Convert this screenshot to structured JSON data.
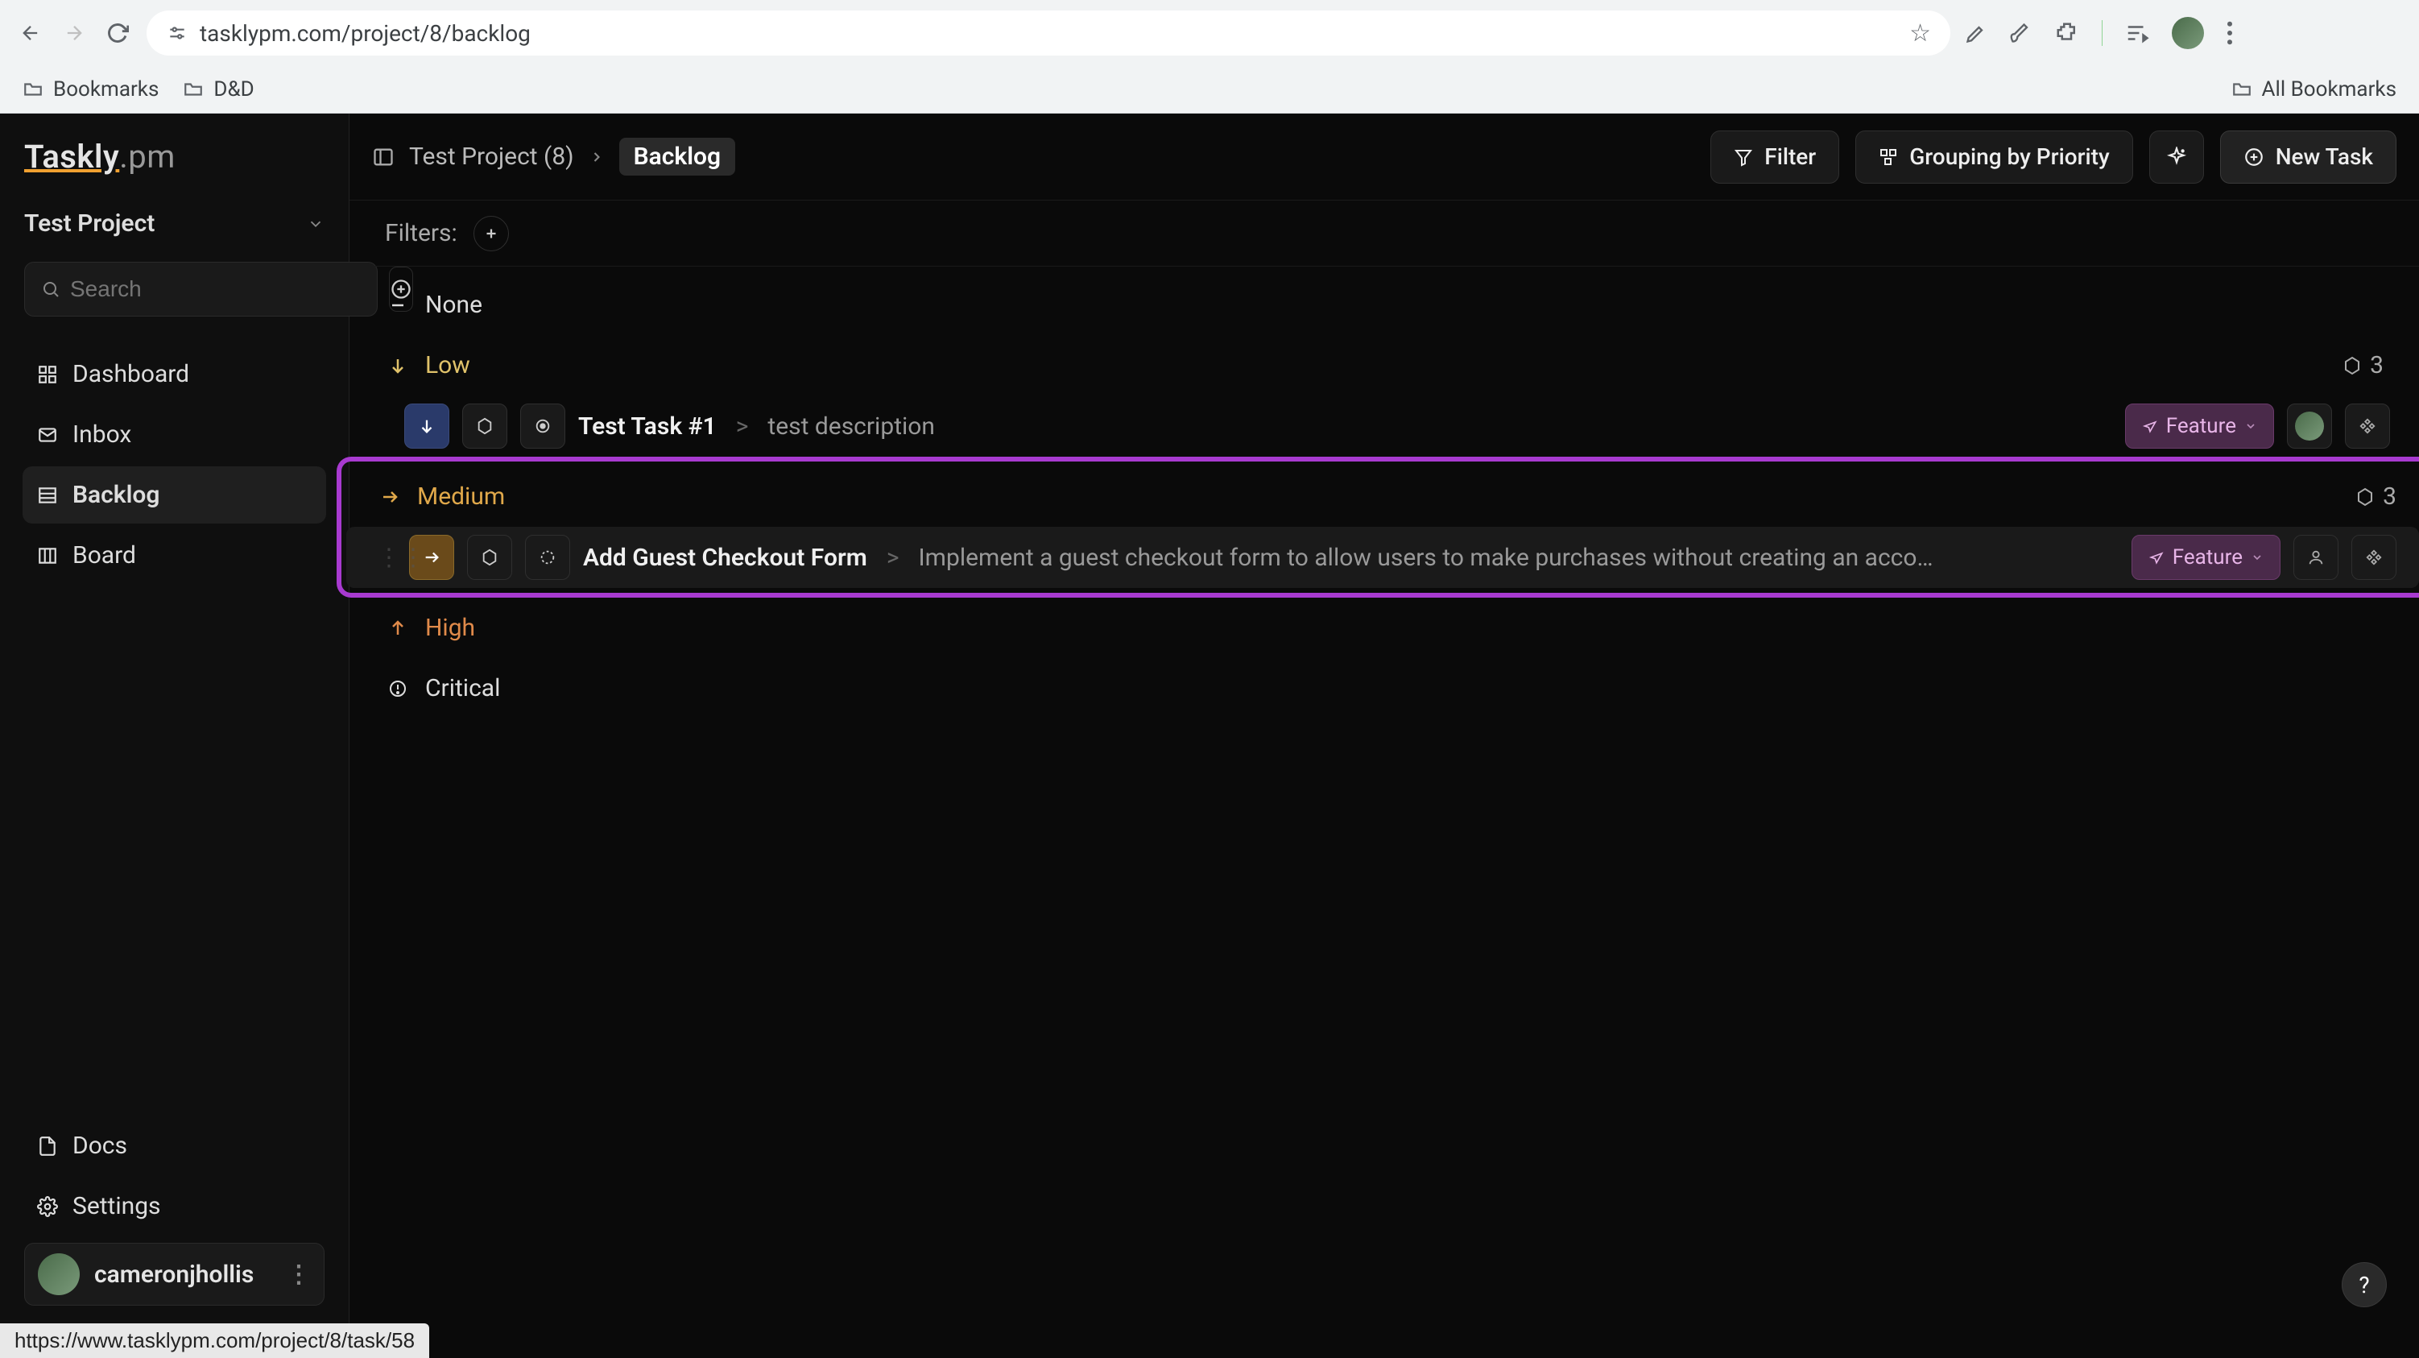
{
  "browser": {
    "url": "tasklypm.com/project/8/backlog",
    "bookmarks": {
      "item1": "Bookmarks",
      "item2": "D&D",
      "all": "All Bookmarks"
    }
  },
  "app": {
    "logo_main": "Taskly",
    "logo_suffix": ".pm",
    "project_name": "Test Project",
    "search_placeholder": "Search",
    "nav": {
      "dashboard": "Dashboard",
      "inbox": "Inbox",
      "backlog": "Backlog",
      "board": "Board"
    },
    "bottom": {
      "docs": "Docs",
      "settings": "Settings"
    },
    "user": "cameronjhollis"
  },
  "topbar": {
    "crumb_project": "Test Project (8)",
    "crumb_current": "Backlog",
    "filter": "Filter",
    "grouping": "Grouping by Priority",
    "new_task": "New Task"
  },
  "filters_label": "Filters:",
  "groups": {
    "none": {
      "label": "None"
    },
    "low": {
      "label": "Low",
      "count": "3",
      "task": {
        "title": "Test Task #1",
        "sep": ">",
        "desc": "test description",
        "tag": "Feature"
      }
    },
    "medium": {
      "label": "Medium",
      "count": "3",
      "task": {
        "title": "Add Guest Checkout Form",
        "sep": ">",
        "desc": "Implement a guest checkout form to allow users to make purchases without creating an acco…",
        "tag": "Feature"
      }
    },
    "high": {
      "label": "High"
    },
    "critical": {
      "label": "Critical"
    }
  },
  "help": "?",
  "status_link": "https://www.tasklypm.com/project/8/task/58"
}
